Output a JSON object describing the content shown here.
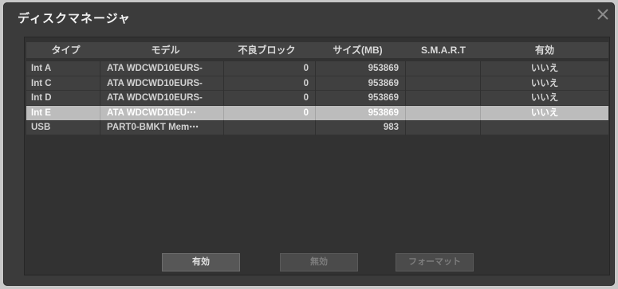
{
  "dialog": {
    "title": "ディスクマネージャ",
    "close_icon": "close-icon"
  },
  "table": {
    "columns": [
      "タイプ",
      "モデル",
      "不良ブロック",
      "サイズ(MB)",
      "S.M.A.R.T",
      "有効"
    ],
    "rows": [
      {
        "type": "Int A",
        "model": "ATA WDCWD10EURS-",
        "bad_blocks": "0",
        "size_mb": "953869",
        "smart": "",
        "enabled": "いいえ",
        "selected": false
      },
      {
        "type": "Int C",
        "model": "ATA WDCWD10EURS-",
        "bad_blocks": "0",
        "size_mb": "953869",
        "smart": "",
        "enabled": "いいえ",
        "selected": false
      },
      {
        "type": "Int D",
        "model": "ATA WDCWD10EURS-",
        "bad_blocks": "0",
        "size_mb": "953869",
        "smart": "",
        "enabled": "いいえ",
        "selected": false
      },
      {
        "type": "Int E",
        "model": "ATA WDCWD10EU⋯",
        "bad_blocks": "0",
        "size_mb": "953869",
        "smart": "",
        "enabled": "いいえ",
        "selected": true
      },
      {
        "type": "USB",
        "model": "PART0-BMKT Mem⋯",
        "bad_blocks": "",
        "size_mb": "983",
        "smart": "",
        "enabled": "",
        "selected": false
      }
    ]
  },
  "buttons": [
    {
      "label": "有効",
      "enabled": true
    },
    {
      "label": "無効",
      "enabled": false
    },
    {
      "label": "フォーマット",
      "enabled": false
    }
  ],
  "colors": {
    "selection_bg": "#bcbcbc",
    "selection_text": "#ffffff",
    "text": "#d2d2d2"
  }
}
